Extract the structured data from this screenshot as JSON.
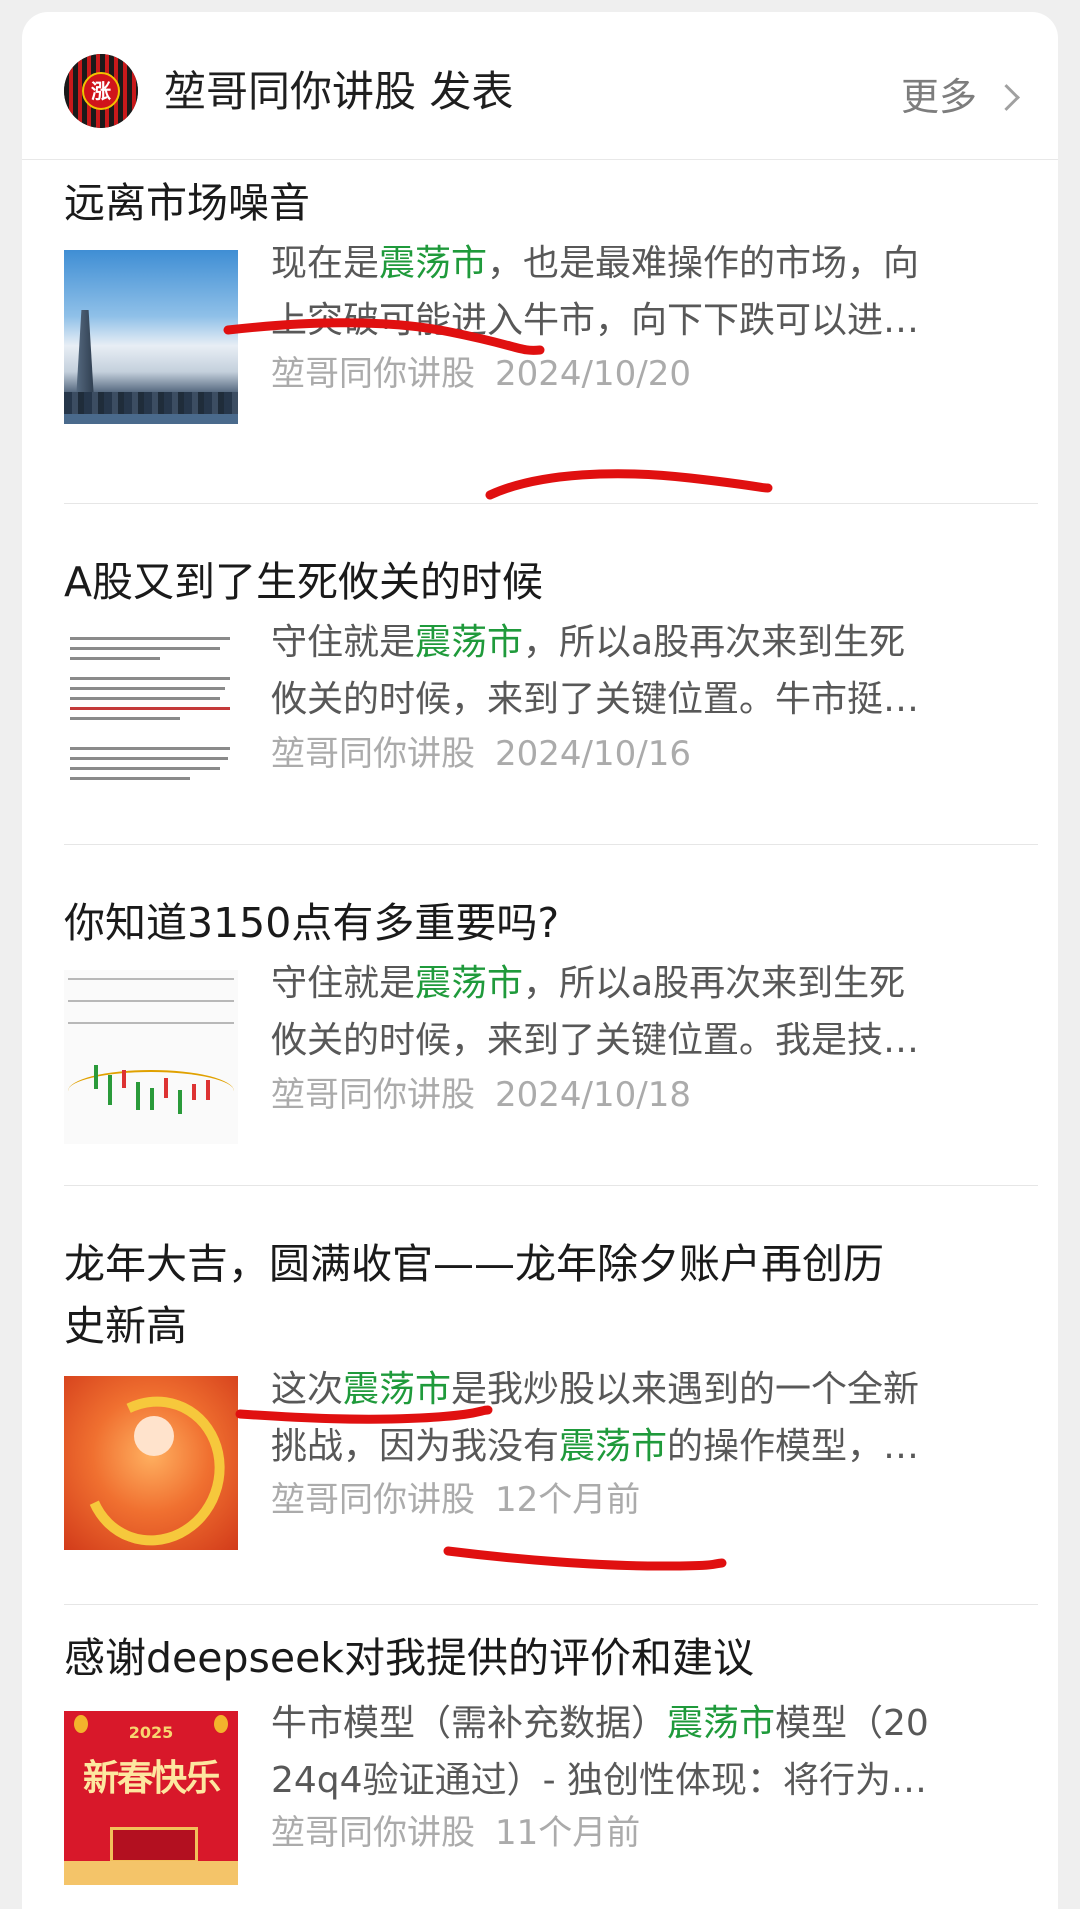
{
  "header": {
    "avatar_text": "涨",
    "title": "堃哥同你讲股 发表",
    "more_label": "更多"
  },
  "articles": [
    {
      "title": "远离市场噪音",
      "summary_line1_a": "现在是",
      "summary_line1_kw": "震荡市",
      "summary_line1_b": "，也是最难操作的市场，向",
      "summary_line2": "上突破可能进入牛市，向下下跌可以进…",
      "author": "堃哥同你讲股",
      "date": "2024/10/20"
    },
    {
      "title": "A股又到了生死攸关的时候",
      "summary_line1_a": "守住就是",
      "summary_line1_kw": "震荡市",
      "summary_line1_b": "，所以a股再次来到生死",
      "summary_line2": "攸关的时候，来到了关键位置。牛市挺…",
      "author": "堃哥同你讲股",
      "date": "2024/10/16"
    },
    {
      "title": "你知道3150点有多重要吗?",
      "summary_line1_a": "守住就是",
      "summary_line1_kw": "震荡市",
      "summary_line1_b": "，所以a股再次来到生死",
      "summary_line2": "攸关的时候，来到了关键位置。我是技…",
      "author": "堃哥同你讲股",
      "date": "2024/10/18"
    },
    {
      "title_line1": "龙年大吉，圆满收官——龙年除夕账户再创历",
      "title_line2": "史新高",
      "summary_line1_a": "这次",
      "summary_line1_kw": "震荡市",
      "summary_line1_b": "是我炒股以来遇到的一个全新",
      "summary_line2_a": "挑战，因为我没有",
      "summary_line2_kw": "震荡市",
      "summary_line2_b": "的操作模型，…",
      "author": "堃哥同你讲股",
      "date": "12个月前"
    },
    {
      "title": "感谢deepseek对我提供的评价和建议",
      "summary_line1_a": "牛市模型（需补充数据）",
      "summary_line1_kw": "震荡市",
      "summary_line1_b": "模型（20",
      "summary_line2": "24q4验证通过）- 独创性体现：将行为…",
      "author": "堃哥同你讲股",
      "date": "11个月前",
      "thumb_year": "2025",
      "thumb_text": "新春快乐"
    }
  ],
  "colors": {
    "keyword": "#1f9a3b",
    "annotation_red": "#e01010"
  }
}
